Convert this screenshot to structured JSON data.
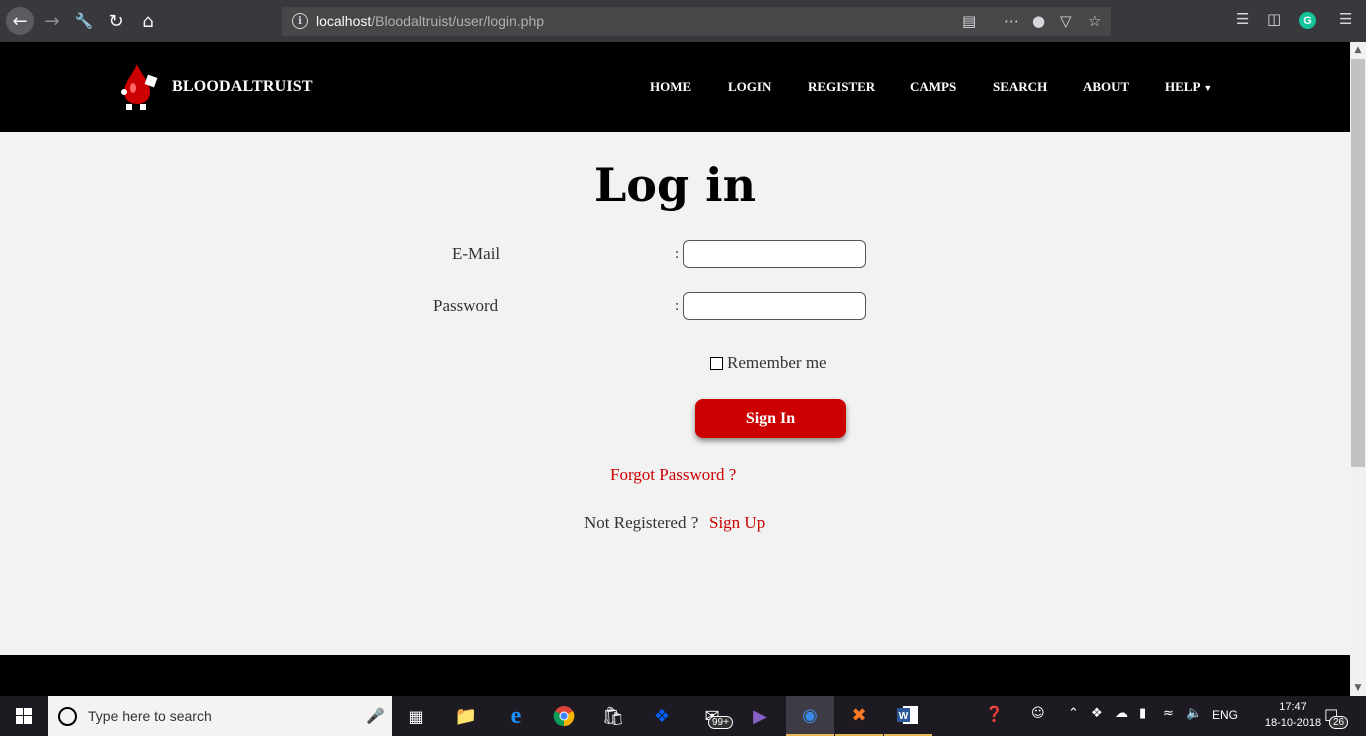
{
  "browser": {
    "url_host": "localhost",
    "url_path": "/Bloodaltruist/user/login.php",
    "grammarly_letter": "G"
  },
  "site": {
    "brand": "BLOODALTRUIST",
    "nav": [
      "HOME",
      "LOGIN",
      "REGISTER",
      "CAMPS",
      "SEARCH",
      "ABOUT",
      "HELP"
    ]
  },
  "login": {
    "title": "Log in",
    "email_label": "E-Mail",
    "password_label": "Password",
    "colon": ":",
    "email_value": "",
    "password_value": "",
    "remember_label": "Remember me",
    "signin_label": "Sign In",
    "forgot_label": "Forgot Password ?",
    "not_registered": "Not Registered ?",
    "signup_label": "Sign Up"
  },
  "taskbar": {
    "search_placeholder": "Type here to search",
    "mail_badge": "99+",
    "lang": "ENG",
    "time": "17:47",
    "date": "18-10-2018",
    "notif_count": "26"
  },
  "colors": {
    "accent_red": "#cc0000",
    "navbar_bg": "#000000",
    "page_bg": "#f2f2f2",
    "browser_bg": "#38383d"
  }
}
